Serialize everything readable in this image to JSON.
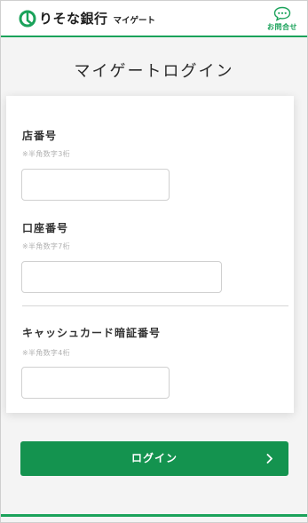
{
  "header": {
    "brand": "りそな銀行",
    "brand_sub": "マイゲート",
    "contact_label": "お問合せ",
    "icons": {
      "logo": "resona-logo-icon",
      "contact": "chat-bubble-icon"
    },
    "accent_color": "#1aa25a"
  },
  "main": {
    "title": "マイゲートログイン",
    "fields": [
      {
        "label": "店番号",
        "hint": "※半角数字3桁",
        "value": ""
      },
      {
        "label": "口座番号",
        "hint": "※半角数字7桁",
        "value": ""
      },
      {
        "label": "キャッシュカード暗証番号",
        "hint": "※半角数字4桁",
        "value": ""
      }
    ],
    "login_button": {
      "label": "ログイン",
      "icon": "chevron-right-icon",
      "color": "#14934f"
    }
  }
}
